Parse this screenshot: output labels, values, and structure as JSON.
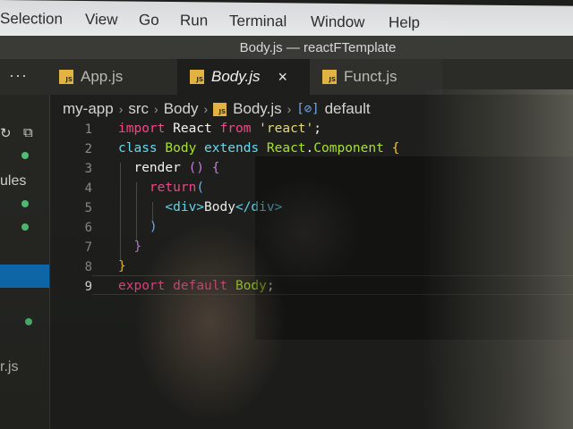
{
  "menubar": {
    "items": [
      "Selection",
      "View",
      "Go",
      "Run",
      "Terminal",
      "Window",
      "Help"
    ]
  },
  "window": {
    "title": "Body.js — reactFTemplate"
  },
  "tabs": [
    {
      "label": "App.js",
      "icon": "js-file-icon",
      "badge": "JS",
      "active": false
    },
    {
      "label": "Body.js",
      "icon": "js-file-icon",
      "badge": "JS",
      "active": true,
      "close": "×"
    },
    {
      "label": "Funct.js",
      "icon": "js-file-icon",
      "badge": "JS",
      "active": false
    }
  ],
  "tabstrip": {
    "more": "···"
  },
  "breadcrumb": {
    "parts": [
      "my-app",
      "src",
      "Body",
      "Body.js",
      "default"
    ],
    "separator": "›",
    "js_badge": "JS",
    "symbol_icon": "[⊘]"
  },
  "sidebar": {
    "items": [
      "ules",
      "r.js"
    ]
  },
  "editor": {
    "line_numbers": [
      "1",
      "2",
      "3",
      "4",
      "5",
      "6",
      "7",
      "8",
      "9"
    ],
    "current_line": 9,
    "lines": [
      [
        {
          "t": "import",
          "c": "kw"
        },
        {
          "t": " React ",
          "c": "plain"
        },
        {
          "t": "from",
          "c": "kw"
        },
        {
          "t": " ",
          "c": "plain"
        },
        {
          "t": "'react'",
          "c": "str"
        },
        {
          "t": ";",
          "c": "plain"
        }
      ],
      [
        {
          "t": "class",
          "c": "kw2"
        },
        {
          "t": " ",
          "c": "plain"
        },
        {
          "t": "Body",
          "c": "cls"
        },
        {
          "t": " ",
          "c": "plain"
        },
        {
          "t": "extends",
          "c": "kw2"
        },
        {
          "t": " ",
          "c": "plain"
        },
        {
          "t": "React",
          "c": "cls"
        },
        {
          "t": ".",
          "c": "plain"
        },
        {
          "t": "Component",
          "c": "cls"
        },
        {
          "t": " ",
          "c": "plain"
        },
        {
          "t": "{",
          "c": "br"
        }
      ],
      [
        {
          "t": "  render ",
          "c": "plain"
        },
        {
          "t": "()",
          "c": "br2"
        },
        {
          "t": " ",
          "c": "plain"
        },
        {
          "t": "{",
          "c": "br2"
        }
      ],
      [
        {
          "t": "    ",
          "c": "plain"
        },
        {
          "t": "return",
          "c": "kw"
        },
        {
          "t": "(",
          "c": "br3"
        }
      ],
      [
        {
          "t": "      ",
          "c": "plain"
        },
        {
          "t": "<div>",
          "c": "tag"
        },
        {
          "t": "Body",
          "c": "plain"
        },
        {
          "t": "</div>",
          "c": "tag"
        }
      ],
      [
        {
          "t": "    ",
          "c": "plain"
        },
        {
          "t": ")",
          "c": "br3"
        }
      ],
      [
        {
          "t": "  ",
          "c": "plain"
        },
        {
          "t": "}",
          "c": "br2"
        }
      ],
      [
        {
          "t": "}",
          "c": "br"
        }
      ],
      [
        {
          "t": "export",
          "c": "kw"
        },
        {
          "t": " ",
          "c": "plain"
        },
        {
          "t": "default",
          "c": "kw"
        },
        {
          "t": " ",
          "c": "plain"
        },
        {
          "t": "Body",
          "c": "cls"
        },
        {
          "t": ";",
          "c": "plain"
        }
      ]
    ]
  },
  "colors": {
    "keyword": "#f5458b",
    "keyword_blue": "#66d9ef",
    "class": "#a6e22e",
    "string": "#e6db74",
    "js_badge": "#e3b341",
    "selection": "#0d6fb8",
    "git_dot": "#4fbf74"
  }
}
